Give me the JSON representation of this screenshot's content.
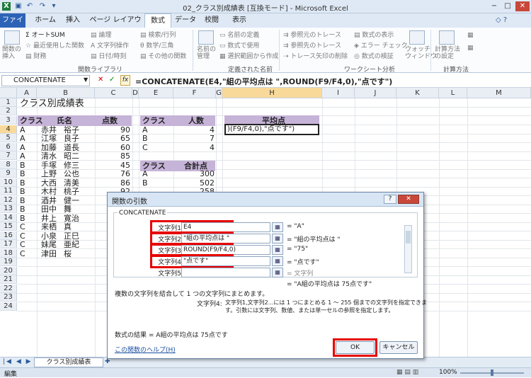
{
  "window": {
    "title": "02_クラス別成績表 [互換モード] - Microsoft Excel"
  },
  "tabs": [
    "ファイル",
    "ホーム",
    "挿入",
    "ページ レイアウト",
    "数式",
    "データ",
    "校閲",
    "表示"
  ],
  "ribbon": {
    "insert_function": "関数の\n挿入",
    "autosum": "オートSUM",
    "recent": "最近使用した関数",
    "financial": "財務",
    "logical": "論理",
    "text": "文字列操作",
    "datetime": "日付/時刻",
    "lookup": "検索/行列",
    "math": "数学/三角",
    "other": "その他の関数",
    "group_library": "関数ライブラリ",
    "name_manager": "名前の\n管理",
    "define_name": "名前の定義",
    "use_in_formula": "数式で使用",
    "create_from_selection": "選択範囲から作成",
    "group_names": "定義された名前",
    "trace_precedents": "参照元のトレース",
    "trace_dependents": "参照先のトレース",
    "remove_arrows": "トレース矢印の削除",
    "show_formulas": "数式の表示",
    "error_check": "エラー チェック",
    "evaluate": "数式の検証",
    "watch": "ウォッチ\nウィンドウ",
    "group_audit": "ワークシート分析",
    "calc_options": "計算方法\nの設定",
    "group_calc": "計算方法"
  },
  "formula_bar": {
    "name_box": "CONCATENATE",
    "formula": "=CONCATENATE(E4,\"組の平均点は \",ROUND(F9/F4,0),\"点です\")"
  },
  "columns": [
    "A",
    "B",
    "C",
    "D",
    "E",
    "F",
    "G",
    "H",
    "I",
    "J",
    "K",
    "L",
    "M"
  ],
  "rows": [
    "1",
    "2",
    "3",
    "4",
    "5",
    "6",
    "7",
    "8",
    "9",
    "10",
    "11",
    "12",
    "13",
    "14",
    "15",
    "16",
    "17",
    "18",
    "19",
    "20",
    "21",
    "22",
    "23",
    "24"
  ],
  "sheet": {
    "title": "クラス別成績表",
    "h_class": "クラス",
    "h_name": "氏名",
    "h_score": "点数",
    "students": [
      [
        "A",
        "赤井",
        "裕子",
        "90"
      ],
      [
        "A",
        "江塚",
        "良子",
        "65"
      ],
      [
        "A",
        "加藤",
        "道長",
        "60"
      ],
      [
        "A",
        "清水",
        "昭二",
        "85"
      ],
      [
        "B",
        "手塚",
        "修三",
        "45"
      ],
      [
        "B",
        "上野",
        "公也",
        "76"
      ],
      [
        "B",
        "大西",
        "清美",
        "86"
      ],
      [
        "B",
        "木村",
        "桃子",
        "92"
      ],
      [
        "B",
        "酒井",
        "健一",
        ""
      ],
      [
        "B",
        "田中",
        "舞",
        ""
      ],
      [
        "B",
        "井上",
        "寛治",
        ""
      ],
      [
        "C",
        "来栖",
        "真",
        ""
      ],
      [
        "C",
        "小泉",
        "正巳",
        ""
      ],
      [
        "C",
        "妹尾",
        "亜紀",
        ""
      ],
      [
        "C",
        "津田",
        "桜",
        ""
      ]
    ],
    "h_class2": "クラス",
    "h_count": "人数",
    "counts": [
      [
        "A",
        "4"
      ],
      [
        "B",
        "7"
      ],
      [
        "C",
        "4"
      ]
    ],
    "h_class3": "クラス",
    "h_total": "合計点",
    "totals": [
      [
        "A",
        "300"
      ],
      [
        "B",
        "502"
      ],
      [
        "",
        "258"
      ]
    ],
    "h_avg": "平均点",
    "h4_edit": ")(F9/F4,0),\"点です\")"
  },
  "sheet_tab": "クラス別成績表",
  "status": {
    "mode": "編集",
    "zoom": "100%"
  },
  "dialog": {
    "title": "関数の引数",
    "func": "CONCATENATE",
    "args": [
      {
        "label": "文字列1",
        "value": "E4",
        "result": "= \"A\""
      },
      {
        "label": "文字列2",
        "value": "\"組の平均点は \"",
        "result": "= \"組の平均点は \""
      },
      {
        "label": "文字列3",
        "value": "ROUND(F9/F4,0)",
        "result": "= \"75\""
      },
      {
        "label": "文字列4",
        "value": "\"点です\"",
        "result": "= \"点です\""
      },
      {
        "label": "文字列5",
        "value": "",
        "result": "= 文字列"
      }
    ],
    "overall": "= \"A組の平均点は 75点です\"",
    "desc": "複数の文字列を結合して 1 つの文字列にまとめます。",
    "arg_name": "文字列4:",
    "arg_desc1": "文字列1,文字列2...には 1 つにまとめる 1 ～ 255 個までの文字列を指定できま",
    "arg_desc2": "す。引数には文字列、数値、または単一セルの参照を指定します。",
    "result_label": "数式の結果 =",
    "result_value": "A組の平均点は 75点です",
    "help": "この関数のヘルプ(H)",
    "ok": "OK",
    "cancel": "キャンセル"
  }
}
